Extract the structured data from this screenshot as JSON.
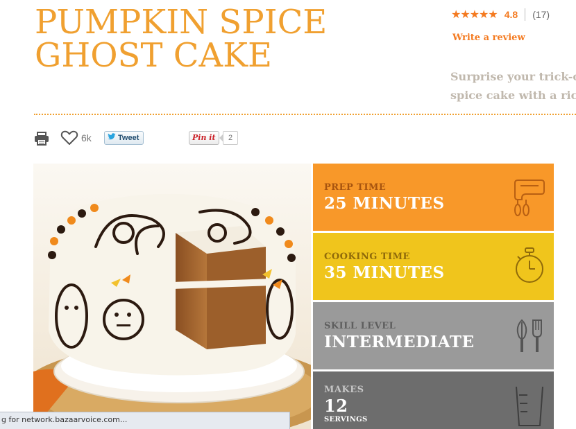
{
  "recipe": {
    "title_line1": "PUMPKIN SPICE",
    "title_line2": "GHOST CAKE",
    "description_line1": "Surprise your trick-or",
    "description_line2": "spice cake with a rich"
  },
  "rating": {
    "stars": "★★★★★",
    "value": "4.8",
    "count": "(17)",
    "write_review": "Write a review",
    "accent_color": "#f47a20"
  },
  "share": {
    "like_count": "6k",
    "tweet_label": "Tweet",
    "pin_label": "Pin it",
    "pin_count": "2"
  },
  "info": {
    "prep_label": "PREP TIME",
    "prep_value": "25 MINUTES",
    "cook_label": "COOKING TIME",
    "cook_value": "35 MINUTES",
    "skill_label": "SKILL LEVEL",
    "skill_value": "INTERMEDIATE",
    "makes_label": "MAKES",
    "makes_value": "12",
    "makes_unit": "SERVINGS"
  },
  "icons": {
    "print": "print-icon",
    "heart": "heart-icon",
    "mixer": "mixer-icon",
    "timer": "timer-icon",
    "utensils": "whisk-spatula-icon",
    "measuring_cup": "measuring-cup-icon"
  },
  "colors": {
    "title": "#f0a030",
    "prep_panel": "#f89829",
    "cook_panel": "#f0c51c",
    "skill_panel": "#9a9a9a",
    "makes_panel": "#6d6d6d"
  },
  "status": {
    "text": "g for network.bazaarvoice.com..."
  }
}
